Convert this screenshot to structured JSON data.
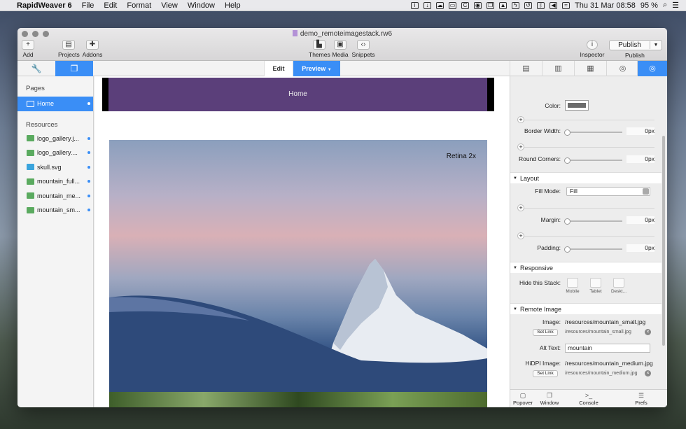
{
  "menubar": {
    "app_name": "RapidWeaver 6",
    "items": [
      "File",
      "Edit",
      "Format",
      "View",
      "Window",
      "Help"
    ],
    "date_time": "Thu 31 Mar  08:58",
    "battery": "95 %"
  },
  "window": {
    "document_title": "demo_remoteimagestack.rw6",
    "toolbar": {
      "add": "Add",
      "projects": "Projects",
      "addons": "Addons",
      "themes": "Themes",
      "media": "Media",
      "snippets": "Snippets",
      "inspector": "Inspector",
      "publish_button": "Publish",
      "publish": "Publish"
    },
    "tabs": {
      "edit": "Edit",
      "preview": "Preview"
    }
  },
  "sidebar": {
    "pages_heading": "Pages",
    "pages": [
      {
        "label": "Home"
      }
    ],
    "resources_heading": "Resources",
    "resources": [
      {
        "label": "logo_gallery.j..."
      },
      {
        "label": "logo_gallery...."
      },
      {
        "label": "skull.svg"
      },
      {
        "label": "mountain_full..."
      },
      {
        "label": "mountain_me..."
      },
      {
        "label": "mountain_sm..."
      }
    ]
  },
  "canvas": {
    "nav_title": "Home",
    "image_badge": "Retina 2x"
  },
  "inspector": {
    "color_label": "Color:",
    "color_value": "#6b6b6b",
    "border_width_label": "Border Width:",
    "border_width_value": "0px",
    "round_corners_label": "Round Corners:",
    "round_corners_value": "0px",
    "layout_heading": "Layout",
    "fill_mode_label": "Fill Mode:",
    "fill_mode_value": "Fill",
    "margin_label": "Margin:",
    "margin_value": "0px",
    "padding_label": "Padding:",
    "padding_value": "0px",
    "responsive_heading": "Responsive",
    "hide_label": "Hide this Stack:",
    "devices": [
      "Mobile",
      "Tablet",
      "Deskt..."
    ],
    "remote_heading": "Remote Image",
    "image_label": "Image:",
    "image_value": "/resources/mountain_small.jpg",
    "image_small": "/resources/mountain_small.jpg",
    "set_link": "Set Link",
    "alt_label": "Alt Text:",
    "alt_value": "mountain",
    "hidpi_label": "HiDPI Image:",
    "hidpi_value": "/resources/mountain_medium.jpg",
    "hidpi_small": "/resources/mountain_medium.jpg",
    "footer": [
      "Popover",
      "Window",
      "Console",
      "Prefs"
    ]
  }
}
